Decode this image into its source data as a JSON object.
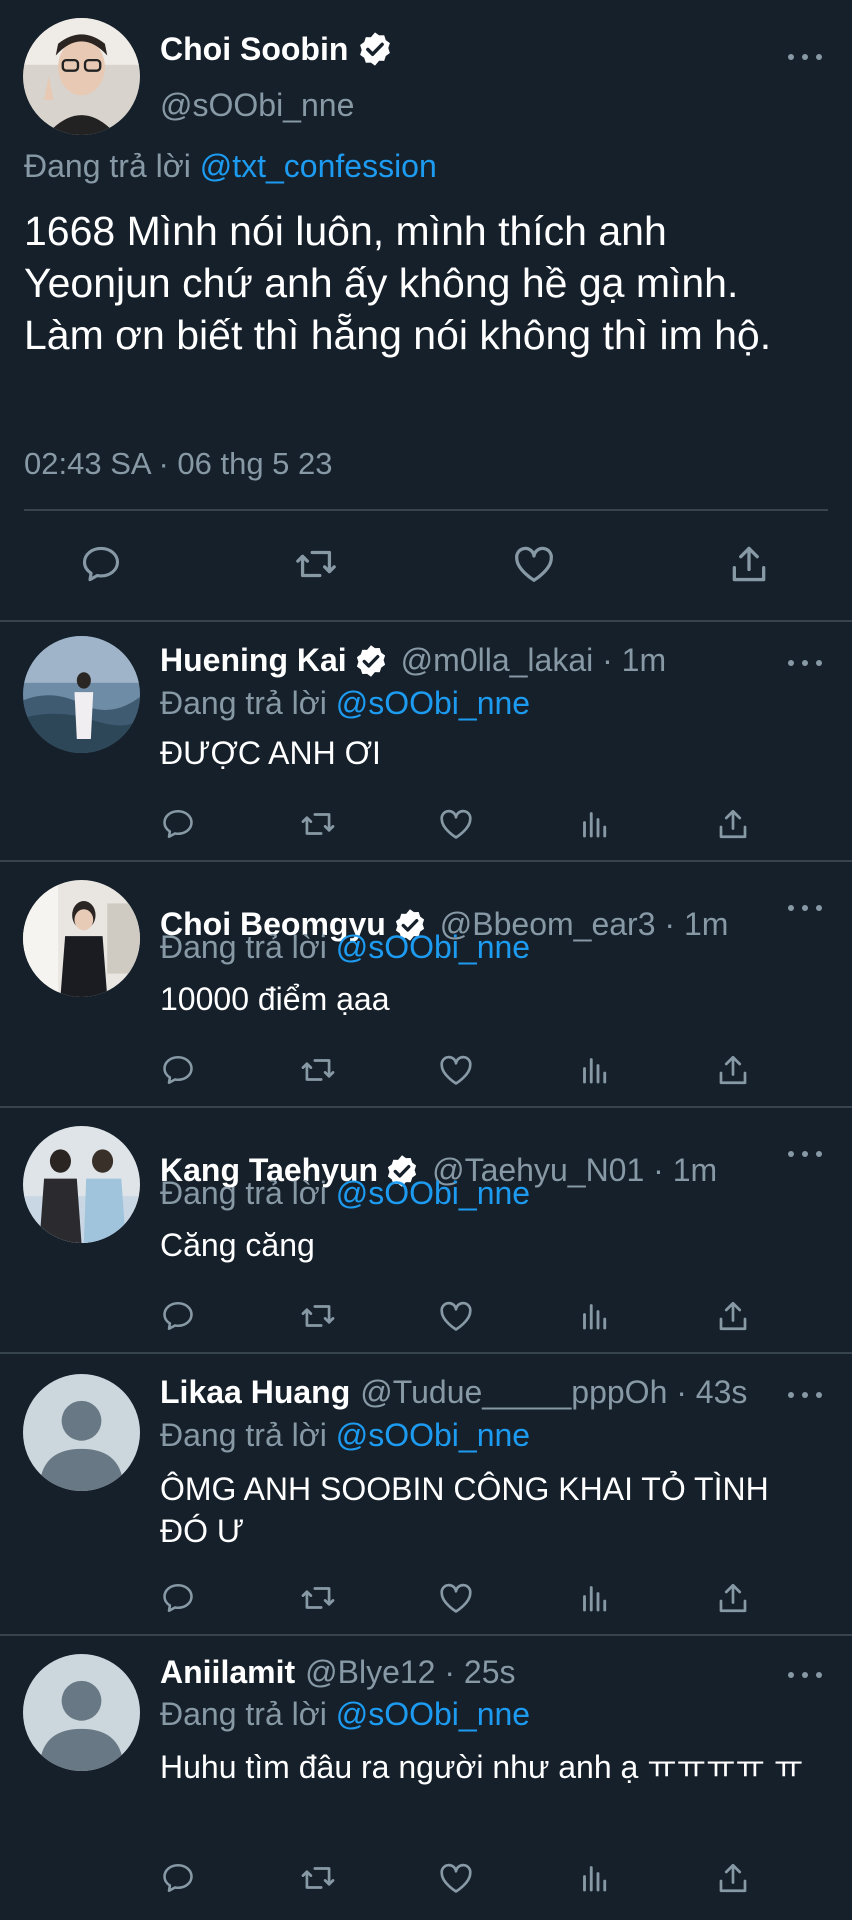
{
  "main": {
    "name": "Choi Soobin",
    "handle": "@sOObi_nne",
    "reply_prefix": "Đang trả lời",
    "reply_handle": "@txt_confession",
    "text": "1668 Mình nói luôn, mình thích anh Yeonjun chứ anh ấy không hề gạ mình. Làm ơn biết thì hẵng nói không thì im hộ.",
    "timestamp": "02:43 SA · 06 thg 5 23"
  },
  "replies": [
    {
      "name": "Huening Kai",
      "verified": true,
      "meta": "@m0lla_lakai · 1m",
      "reply_prefix": "Đang trả lời",
      "reply_handle": "@sOObi_nne",
      "text": "ĐƯỢC ANH ƠI"
    },
    {
      "name": "Choi Beomgyu",
      "verified": true,
      "meta": "@Bbeom_ear3 · 1m",
      "reply_prefix": "Đang trả lời",
      "reply_handle": "@sOObi_nne",
      "text": "10000 điểm ạaa"
    },
    {
      "name": "Kang Taehyun",
      "verified": true,
      "meta": "@Taehyu_N01 · 1m",
      "reply_prefix": "Đang trả lời",
      "reply_handle": "@sOObi_nne",
      "text": "Căng căng"
    },
    {
      "name": "Likaa Huang",
      "verified": false,
      "meta": "@Tudue_____pppOh · 43s",
      "reply_prefix": "Đang trả lời",
      "reply_handle": "@sOObi_nne",
      "text": "ÔMG ANH SOOBIN CÔNG KHAI TỎ TÌNH ĐÓ Ư"
    },
    {
      "name": "Aniilamit",
      "verified": false,
      "meta": "@Blye12 · 25s",
      "reply_prefix": "Đang trả lời",
      "reply_handle": "@sOObi_nne",
      "text": "Huhu tìm đâu ra người như anh ạ ㅠㅠㅠㅠ ㅠ"
    }
  ],
  "icons": {
    "reply": "reply-icon",
    "retweet": "retweet-icon",
    "like": "heart-icon",
    "views": "views-icon",
    "share": "share-icon",
    "verified": "verified-badge-icon",
    "more": "more-icon"
  },
  "colors": {
    "background": "#15202b",
    "link": "#1d9bf0",
    "muted": "#8899a6",
    "divider": "#38444d"
  }
}
